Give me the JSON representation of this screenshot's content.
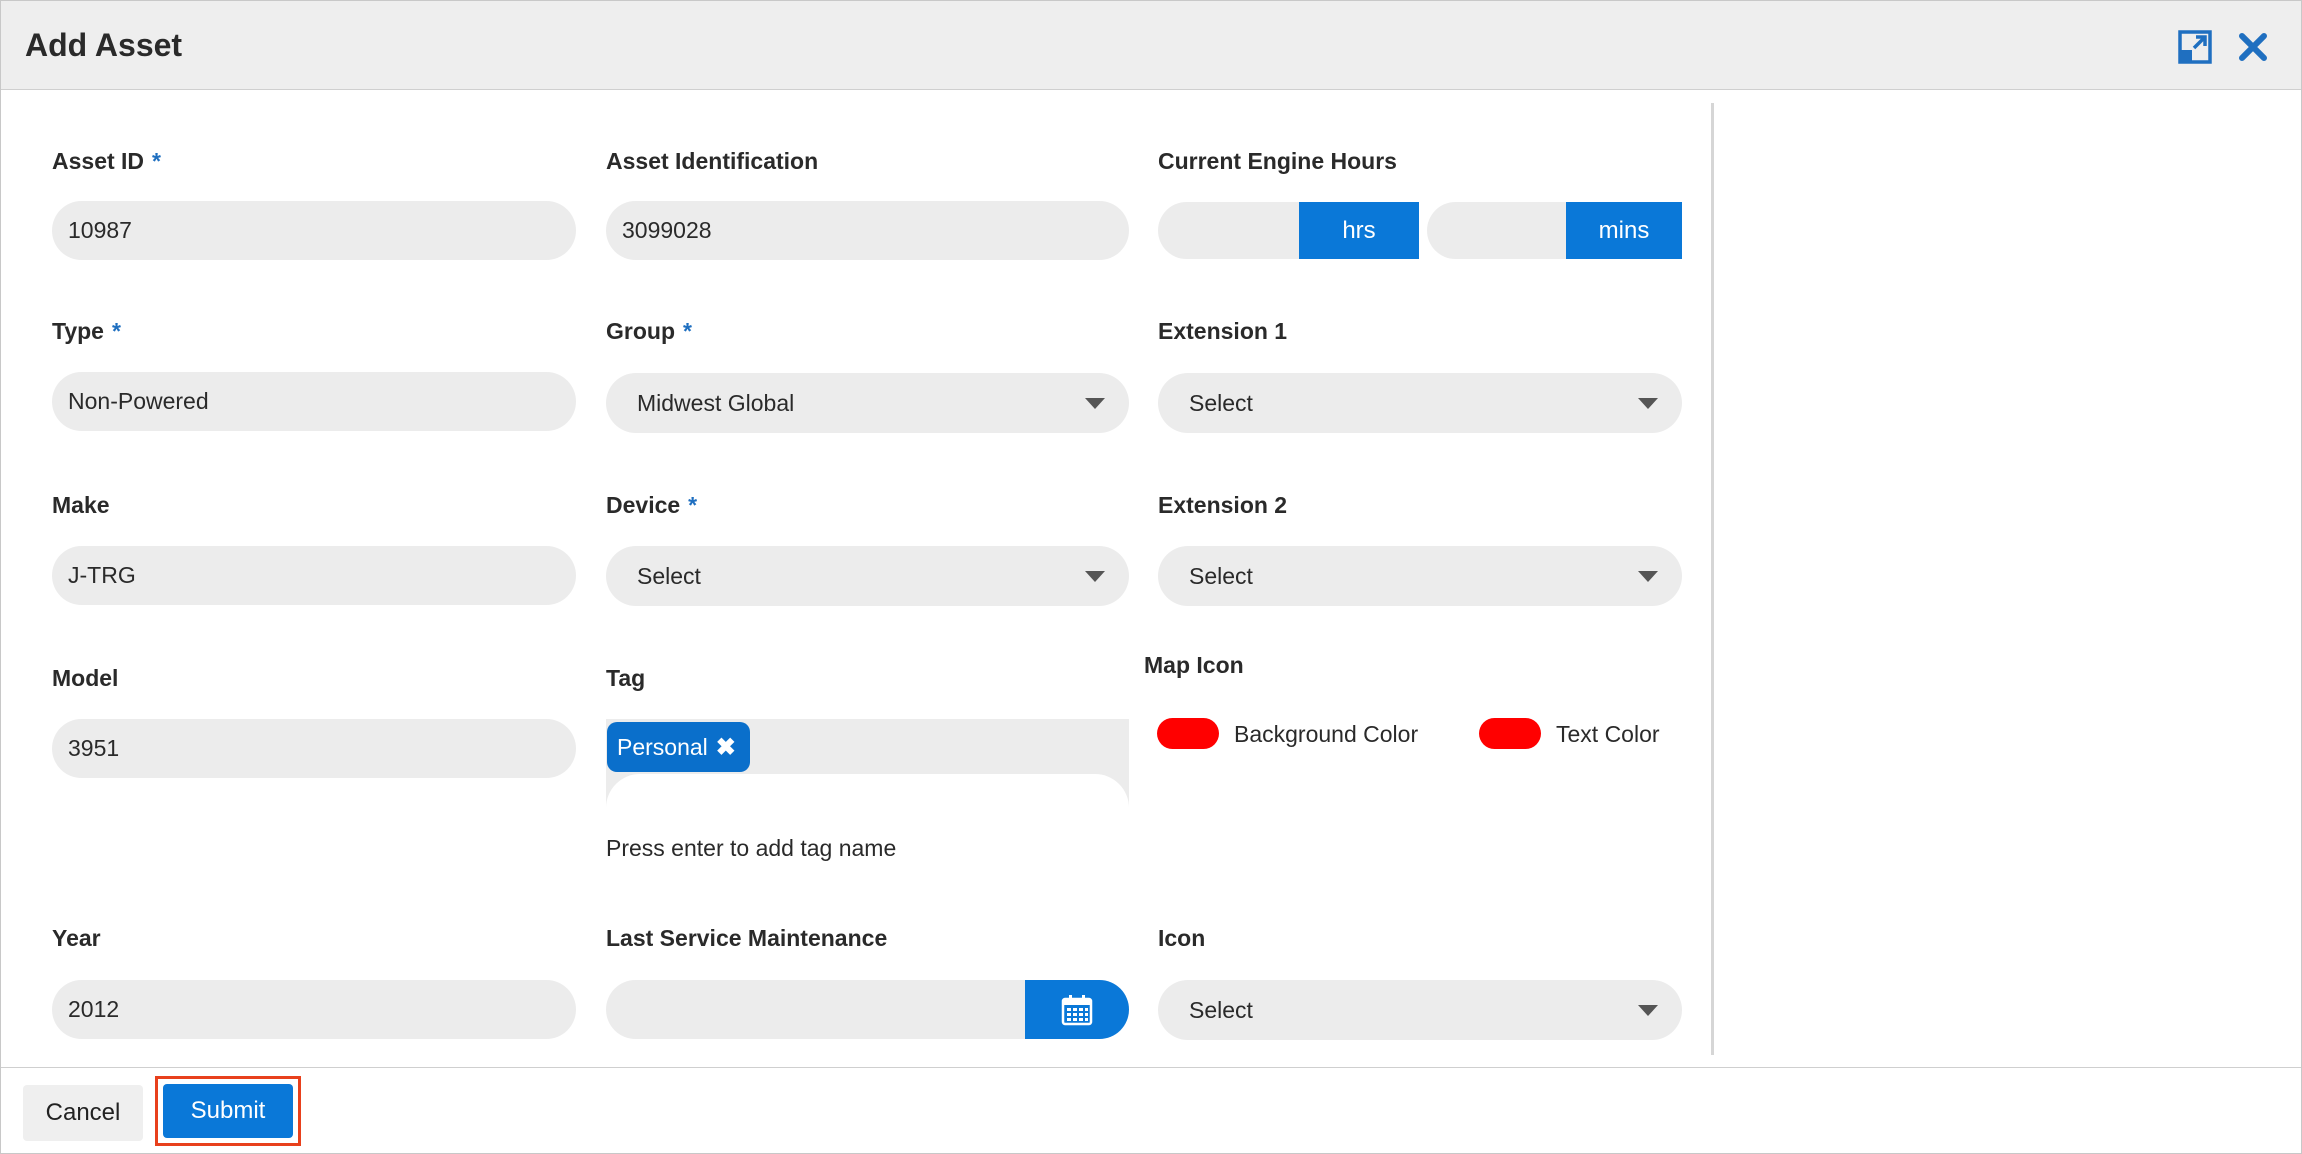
{
  "dialog": {
    "title": "Add Asset"
  },
  "fields": {
    "asset_id": {
      "label": "Asset ID",
      "required": "*",
      "value": "10987"
    },
    "asset_identification": {
      "label": "Asset Identification",
      "value": "3099028"
    },
    "engine_hours": {
      "label": "Current Engine Hours",
      "hours_value": "",
      "hours_unit": "hrs",
      "minutes_value": "",
      "minutes_unit": "mins"
    },
    "type": {
      "label": "Type",
      "required": "*",
      "value": "Non-Powered"
    },
    "group": {
      "label": "Group",
      "required": "*",
      "value": "Midwest Global"
    },
    "extension1": {
      "label": "Extension 1",
      "value": "Select"
    },
    "make": {
      "label": "Make",
      "value": "J-TRG"
    },
    "device": {
      "label": "Device",
      "required": "*",
      "value": "Select"
    },
    "extension2": {
      "label": "Extension 2",
      "value": "Select"
    },
    "model": {
      "label": "Model",
      "value": "3951"
    },
    "tag": {
      "label": "Tag",
      "chips": [
        "Personal"
      ],
      "hint": "Press enter to add tag name"
    },
    "map_icon": {
      "label": "Map Icon",
      "background_color_label": "Background Color",
      "background_color": "#ff0000",
      "text_color_label": "Text Color",
      "text_color": "#ff0000"
    },
    "year": {
      "label": "Year",
      "value": "2012"
    },
    "last_service": {
      "label": "Last Service Maintenance",
      "value": ""
    },
    "icon": {
      "label": "Icon",
      "value": "Select"
    }
  },
  "footer": {
    "cancel_label": "Cancel",
    "submit_label": "Submit"
  },
  "colors": {
    "accent": "#0a78d8",
    "tag_chip": "#0a6fcb",
    "highlight_outline": "#e8401c",
    "field_bg": "#ececec"
  },
  "icons": {
    "expand": "expand-icon",
    "close": "close-icon",
    "calendar": "calendar-icon",
    "caret": "chevron-down-icon",
    "chip_remove": "close-icon"
  }
}
